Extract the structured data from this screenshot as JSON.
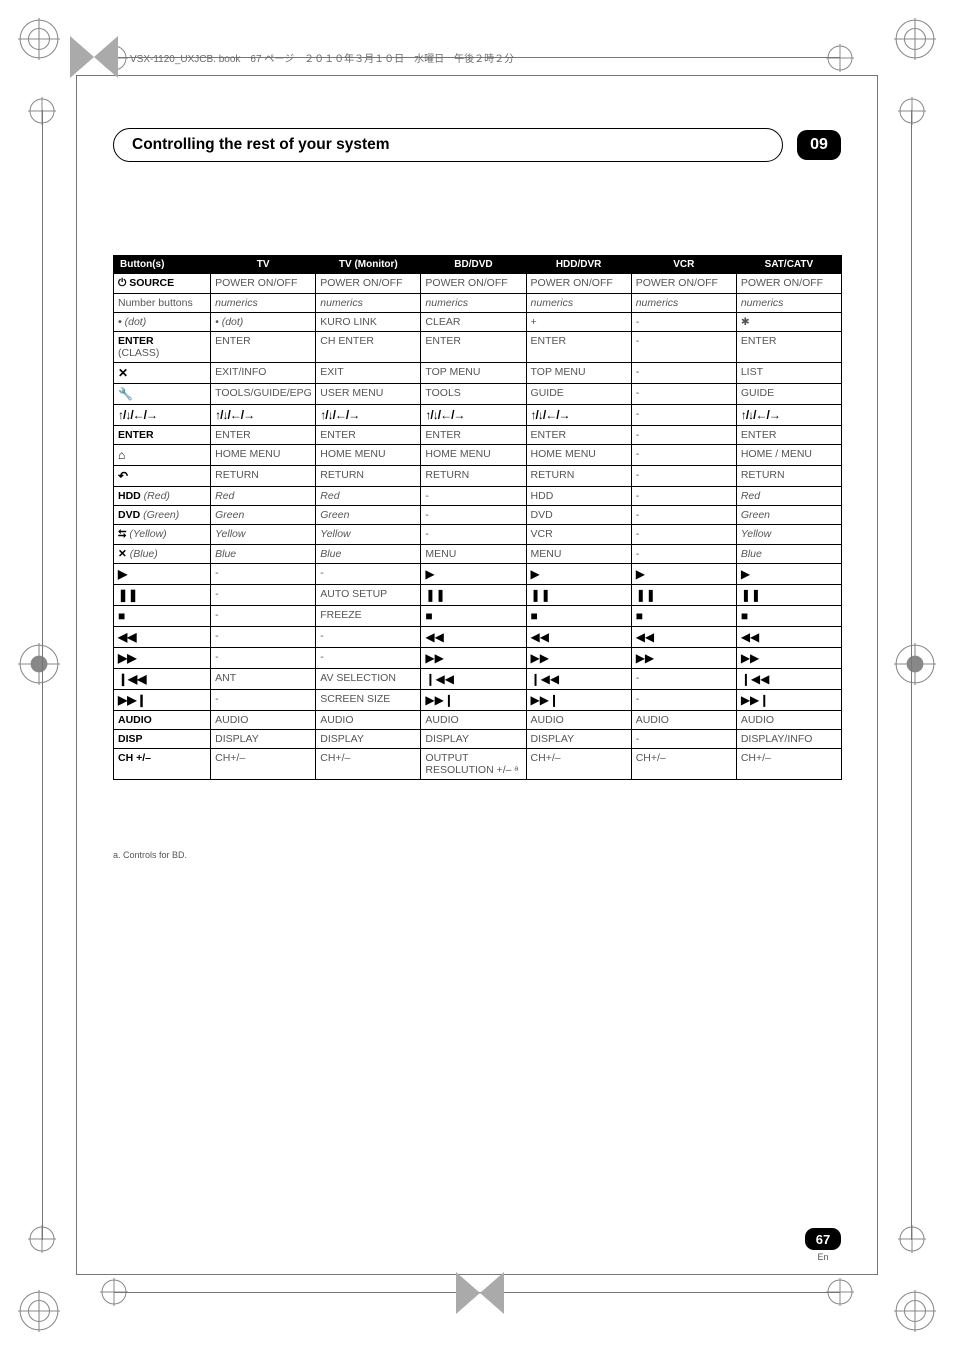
{
  "header_info": "VSX-1120_UXJCB. book　67 ページ　２０１０年３月１０日　水曜日　午後２時２分",
  "chapter_title": "Controlling the rest of your system",
  "chapter_number": "09",
  "page_number": "67",
  "page_lang": "En",
  "footnote": "a. Controls for BD.",
  "columns": [
    "Button(s)",
    "TV",
    "TV (Monitor)",
    "BD/DVD",
    "HDD/DVR",
    "VCR",
    "SAT/CATV"
  ],
  "arrow_glyph": "↑/↓/←/→",
  "rows": [
    {
      "b": "⏻ SOURCE",
      "bclass": "bh",
      "c": [
        "POWER ON/OFF",
        "POWER ON/OFF",
        "POWER ON/OFF",
        "POWER ON/OFF",
        "POWER ON/OFF",
        "POWER ON/OFF"
      ],
      "cls": [
        "gray",
        "gray",
        "gray",
        "gray",
        "gray",
        "gray"
      ]
    },
    {
      "b": "Number buttons",
      "bclass": "gray",
      "c": [
        "numerics",
        "numerics",
        "numerics",
        "numerics",
        "numerics",
        "numerics"
      ],
      "cls": [
        "ital",
        "ital",
        "ital",
        "ital",
        "ital",
        "ital"
      ]
    },
    {
      "b": "• (dot)",
      "bclass": "bh ital",
      "c": [
        "• (dot)",
        "KURO LINK",
        "CLEAR",
        "+",
        "-",
        "✱"
      ],
      "cls": [
        "ital",
        "gray",
        "gray",
        "gray",
        "gray",
        "gray"
      ]
    },
    {
      "b": "ENTER (CLASS)",
      "bclass": "bh",
      "c": [
        "ENTER",
        "CH ENTER",
        "ENTER",
        "ENTER",
        "-",
        "ENTER"
      ],
      "cls": [
        "gray",
        "gray",
        "gray",
        "gray",
        "gray",
        "gray"
      ]
    },
    {
      "b": "✕",
      "bclass": "bh sym",
      "c": [
        "EXIT/INFO",
        "EXIT",
        "TOP MENU",
        "TOP MENU",
        "-",
        "LIST"
      ],
      "cls": [
        "gray",
        "gray",
        "gray",
        "gray",
        "gray",
        "gray"
      ]
    },
    {
      "b": "🔧",
      "bclass": "bh sym",
      "c": [
        "TOOLS/GUIDE/EPG",
        "USER MENU",
        "TOOLS",
        "GUIDE",
        "-",
        "GUIDE"
      ],
      "cls": [
        "gray",
        "gray",
        "gray",
        "gray",
        "gray",
        "gray"
      ]
    },
    {
      "b": "↑/↓/←/→",
      "bclass": "bh arrows",
      "c": [
        "↑/↓/←/→",
        "↑/↓/←/→",
        "↑/↓/←/→",
        "↑/↓/←/→",
        "-",
        "↑/↓/←/→"
      ],
      "cls": [
        "arrows",
        "arrows",
        "arrows",
        "arrows",
        "gray",
        "arrows"
      ]
    },
    {
      "b": "ENTER",
      "bclass": "bh",
      "c": [
        "ENTER",
        "ENTER",
        "ENTER",
        "ENTER",
        "-",
        "ENTER"
      ],
      "cls": [
        "gray",
        "gray",
        "gray",
        "gray",
        "gray",
        "gray"
      ]
    },
    {
      "b": "⌂",
      "bclass": "bh sym",
      "c": [
        "HOME MENU",
        "HOME MENU",
        "HOME MENU",
        "HOME MENU",
        "-",
        "HOME / MENU"
      ],
      "cls": [
        "gray",
        "gray",
        "gray",
        "gray",
        "gray",
        "gray"
      ]
    },
    {
      "b": "↶",
      "bclass": "bh sym",
      "c": [
        "RETURN",
        "RETURN",
        "RETURN",
        "RETURN",
        "-",
        "RETURN"
      ],
      "cls": [
        "gray",
        "gray",
        "gray",
        "gray",
        "gray",
        "gray"
      ]
    },
    {
      "b": "HDD (Red)",
      "bclass": "bh",
      "c": [
        "Red",
        "Red",
        "-",
        "HDD",
        "-",
        "Red"
      ],
      "cls": [
        "ital",
        "ital",
        "gray",
        "gray",
        "gray",
        "ital"
      ]
    },
    {
      "b": "DVD (Green)",
      "bclass": "bh",
      "c": [
        "Green",
        "Green",
        "-",
        "DVD",
        "-",
        "Green"
      ],
      "cls": [
        "ital",
        "ital",
        "gray",
        "gray",
        "gray",
        "ital"
      ]
    },
    {
      "b": "⮀ (Yellow)",
      "bclass": "bh",
      "c": [
        "Yellow",
        "Yellow",
        "-",
        "VCR",
        "-",
        "Yellow"
      ],
      "cls": [
        "ital",
        "ital",
        "gray",
        "gray",
        "gray",
        "ital"
      ]
    },
    {
      "b": "✕ (Blue)",
      "bclass": "bh",
      "c": [
        "Blue",
        "Blue",
        "MENU",
        "MENU",
        "-",
        "Blue"
      ],
      "cls": [
        "ital",
        "ital",
        "gray",
        "gray",
        "gray",
        "ital"
      ]
    },
    {
      "b": "▶",
      "bclass": "bh sym",
      "c": [
        "-",
        "-",
        "▶",
        "▶",
        "▶",
        "▶"
      ],
      "cls": [
        "gray",
        "gray",
        "sym",
        "sym",
        "sym",
        "sym"
      ]
    },
    {
      "b": "❚❚",
      "bclass": "bh sym",
      "c": [
        "-",
        "AUTO SETUP",
        "❚❚",
        "❚❚",
        "❚❚",
        "❚❚"
      ],
      "cls": [
        "gray",
        "gray",
        "sym",
        "sym",
        "sym",
        "sym"
      ]
    },
    {
      "b": "■",
      "bclass": "bh sym",
      "c": [
        "-",
        "FREEZE",
        "■",
        "■",
        "■",
        "■"
      ],
      "cls": [
        "gray",
        "gray",
        "sym",
        "sym",
        "sym",
        "sym"
      ]
    },
    {
      "b": "◀◀",
      "bclass": "bh sym",
      "c": [
        "-",
        "-",
        "◀◀",
        "◀◀",
        "◀◀",
        "◀◀"
      ],
      "cls": [
        "gray",
        "gray",
        "sym",
        "sym",
        "sym",
        "sym"
      ]
    },
    {
      "b": "▶▶",
      "bclass": "bh sym",
      "c": [
        "-",
        "-",
        "▶▶",
        "▶▶",
        "▶▶",
        "▶▶"
      ],
      "cls": [
        "gray",
        "gray",
        "sym",
        "sym",
        "sym",
        "sym"
      ]
    },
    {
      "b": "❙◀◀",
      "bclass": "bh sym",
      "c": [
        "ANT",
        "AV SELECTION",
        "❙◀◀",
        "❙◀◀",
        "-",
        "❙◀◀"
      ],
      "cls": [
        "gray",
        "gray",
        "sym",
        "sym",
        "gray",
        "sym"
      ]
    },
    {
      "b": "▶▶❙",
      "bclass": "bh sym",
      "c": [
        "-",
        "SCREEN SIZE",
        "▶▶❙",
        "▶▶❙",
        "-",
        "▶▶❙"
      ],
      "cls": [
        "gray",
        "gray",
        "sym",
        "sym",
        "gray",
        "sym"
      ]
    },
    {
      "b": "AUDIO",
      "bclass": "bh",
      "c": [
        "AUDIO",
        "AUDIO",
        "AUDIO",
        "AUDIO",
        "AUDIO",
        "AUDIO"
      ],
      "cls": [
        "gray",
        "gray",
        "gray",
        "gray",
        "gray",
        "gray"
      ]
    },
    {
      "b": "DISP",
      "bclass": "bh",
      "c": [
        "DISPLAY",
        "DISPLAY",
        "DISPLAY",
        "DISPLAY",
        "-",
        "DISPLAY/INFO"
      ],
      "cls": [
        "gray",
        "gray",
        "gray",
        "gray",
        "gray",
        "gray"
      ]
    },
    {
      "b": "CH +/–",
      "bclass": "bh",
      "c": [
        "CH+/–",
        "CH+/–",
        "OUTPUT RESOLUTION +/– ᵃ",
        "CH+/–",
        "CH+/–",
        "CH+/–"
      ],
      "cls": [
        "gray",
        "gray",
        "gray",
        "gray",
        "gray",
        "gray"
      ]
    }
  ]
}
